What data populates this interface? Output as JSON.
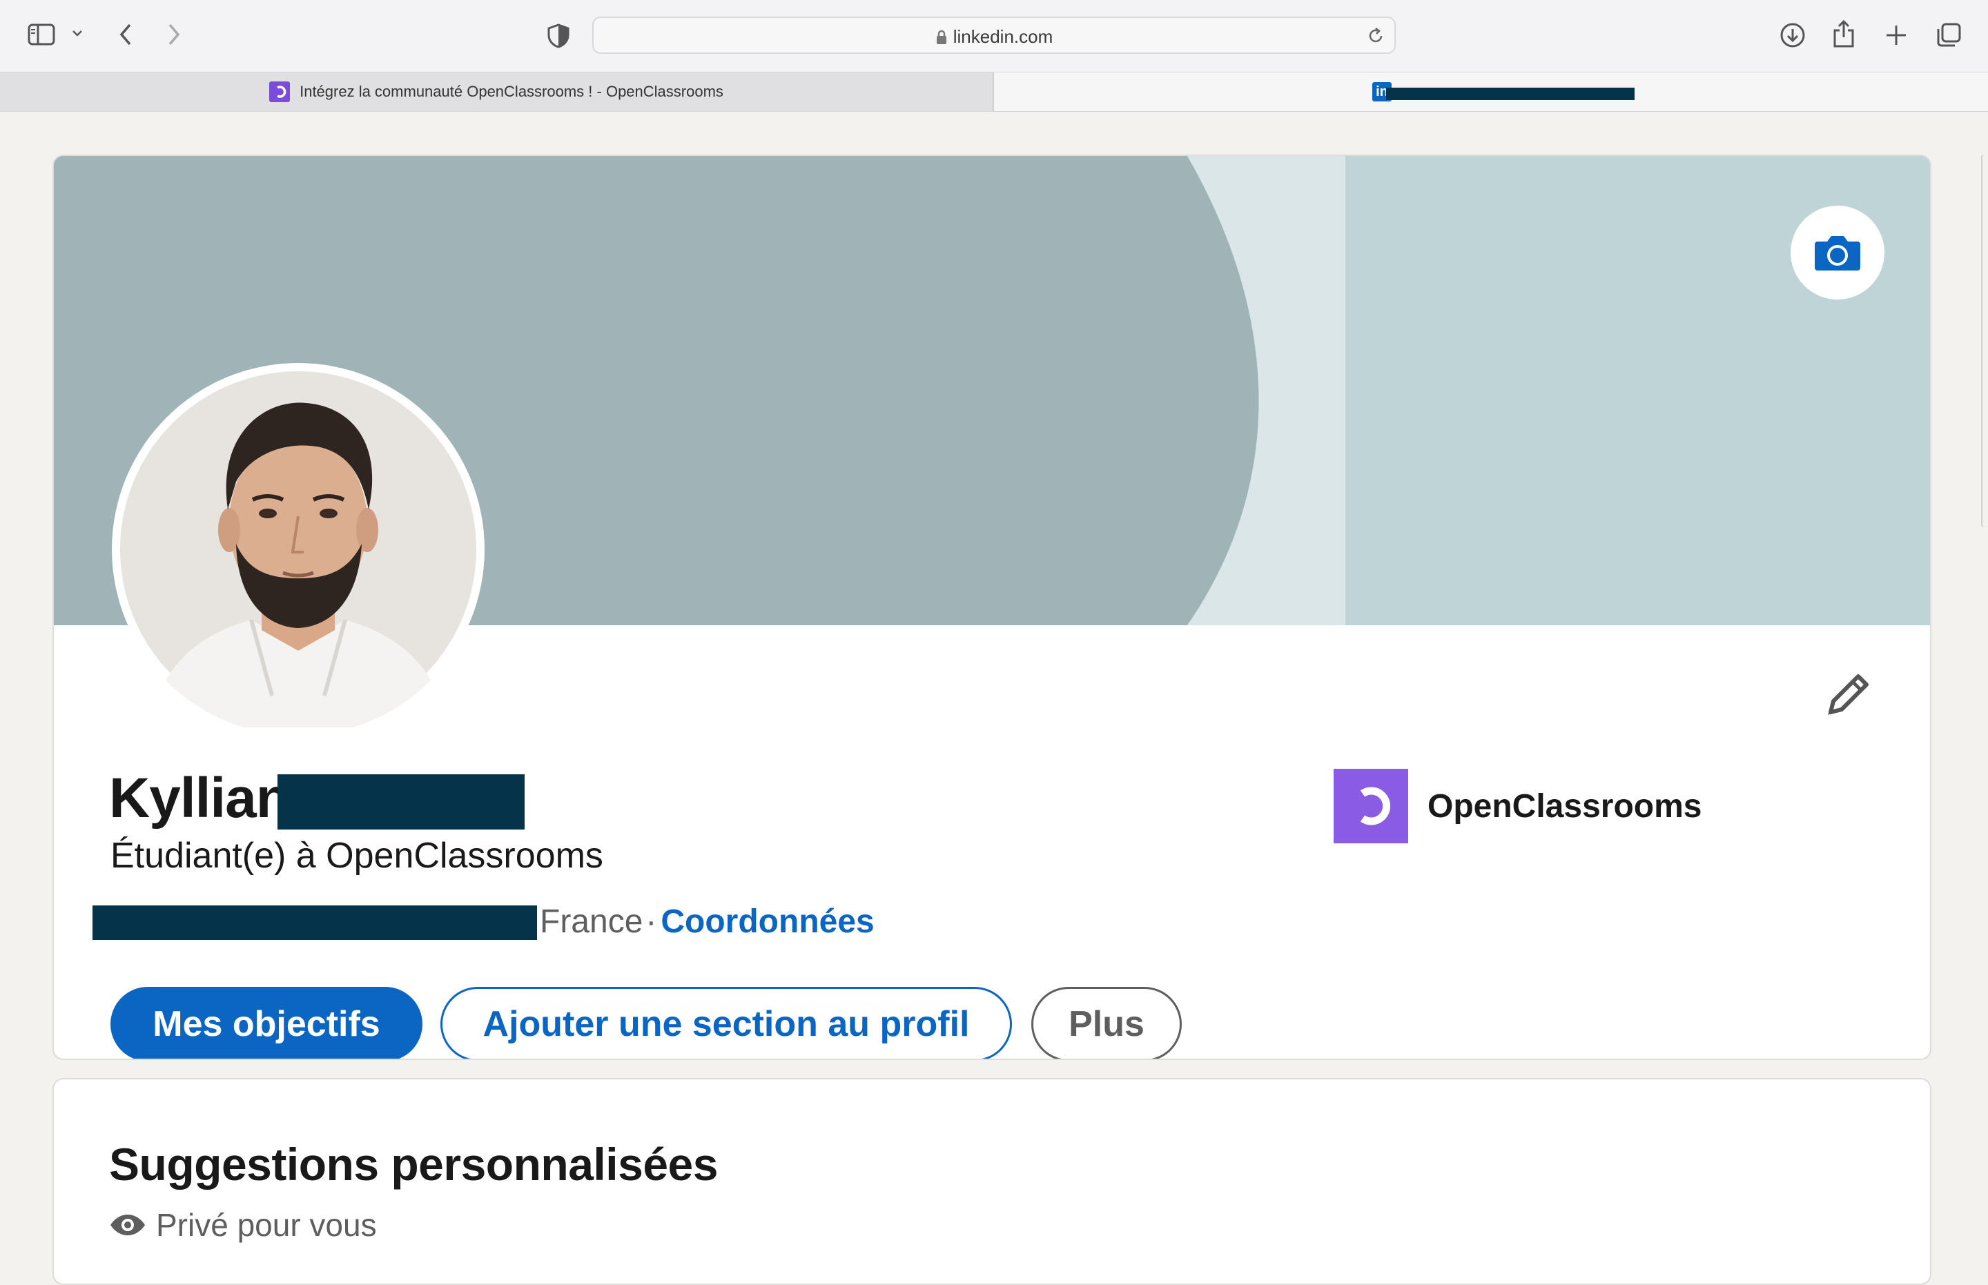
{
  "browser": {
    "url": "linkedin.com",
    "tabs": [
      {
        "label": "Intégrez la communauté OpenClassrooms ! - OpenClassrooms",
        "active": true,
        "icon": "openclassrooms-favicon"
      },
      {
        "label": "",
        "active": false,
        "icon": "linkedin-favicon"
      }
    ]
  },
  "profile": {
    "first_name": "Kyllian",
    "headline": "Étudiant(e) à OpenClassrooms",
    "location_country": "France",
    "separator": "·",
    "contact_link": "Coordonnées",
    "company_name": "OpenClassrooms",
    "actions": {
      "primary": "Mes objectifs",
      "add_section": "Ajouter une section au profil",
      "more": "Plus"
    }
  },
  "suggestions": {
    "title": "Suggestions personnalisées",
    "subtitle": "Privé pour vous"
  },
  "colors": {
    "linkedin_blue": "#0a66c2",
    "banner_dark": "#a0b4b7",
    "banner_light": "#dbe6e8",
    "banner_right": "#bed4d7",
    "openclassrooms_purple": "#8a5ce6"
  }
}
